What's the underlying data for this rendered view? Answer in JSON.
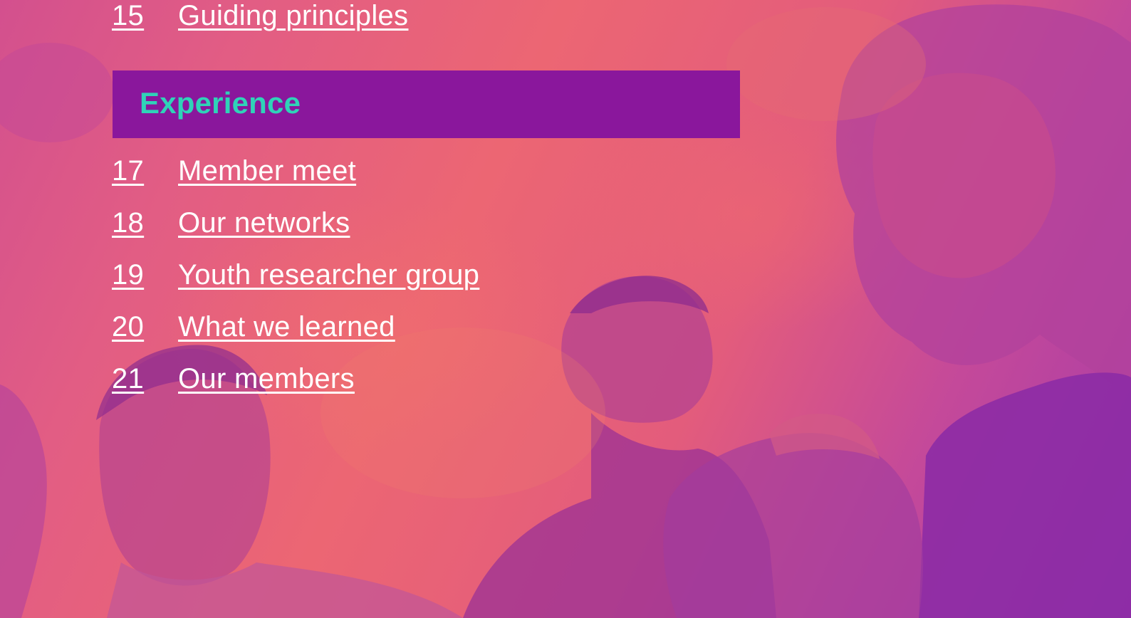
{
  "colors": {
    "banner_bg": "#8a179c",
    "banner_text": "#2fd3b8",
    "link_text": "#ffffff",
    "overlay_gradient": [
      "#d3508e",
      "#ec6673",
      "#a63ba8"
    ]
  },
  "background": {
    "icon": "duotone-photo-smiling-people"
  },
  "toc": {
    "previous_items": [
      {
        "number": "15",
        "label": "Guiding principles"
      }
    ],
    "section": {
      "title": "Experience"
    },
    "items": [
      {
        "number": "17",
        "label": "Member meet"
      },
      {
        "number": "18",
        "label": "Our networks"
      },
      {
        "number": "19",
        "label": "Youth researcher group"
      },
      {
        "number": "20",
        "label": "What we learned"
      },
      {
        "number": "21",
        "label": "Our members"
      }
    ]
  }
}
